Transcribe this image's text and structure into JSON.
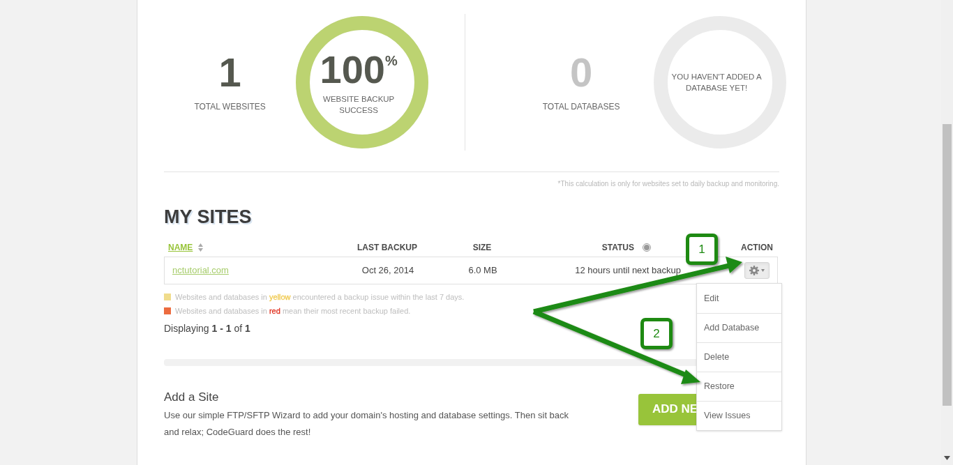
{
  "stats": [
    {
      "kind": "count",
      "value": "1",
      "label": "TOTAL WEBSITES",
      "muted": false
    },
    {
      "kind": "ring",
      "value": "100",
      "unit": "%",
      "label": "WEBSITE BACKUP SUCCESS",
      "level": 1
    },
    {
      "kind": "count",
      "value": "0",
      "label": "TOTAL DATABASES",
      "muted": true
    },
    {
      "kind": "ring",
      "message": "YOU HAVEN'T ADDED A DATABASE YET!",
      "level": 0
    }
  ],
  "footnote": "*This calculation is only for websites set to daily backup and monitoring.",
  "section_title": "MY SITES",
  "table": {
    "columns": [
      {
        "label": "NAME",
        "sorted": true
      },
      {
        "label": "LAST BACKUP",
        "sorted": false
      },
      {
        "label": "SIZE",
        "sorted": false
      },
      {
        "label": "STATUS",
        "sorted": false
      },
      {
        "label": "ACTION",
        "sorted": false
      }
    ],
    "rows": [
      {
        "name": "nctutorial.com",
        "last_backup": "Oct 26, 2014",
        "size": "6.0 MB",
        "status": "12 hours until next backup"
      }
    ]
  },
  "legend": [
    {
      "color": "#f0dc8c",
      "before": "Websites and databases in",
      "highlight": {
        "text": "yellow",
        "color": "#efc84a"
      },
      "after": "encountered a backup issue within the last 7 days."
    },
    {
      "color": "#ec6b3f",
      "before": "Websites and databases in",
      "highlight": {
        "text": "red",
        "color": "#e0301e"
      },
      "after": "mean their most recent backup failed."
    }
  ],
  "pagination": "Displaying **1 - 1** of **1**",
  "add_site": {
    "title": "Add a Site",
    "text": "Use our simple FTP/SFTP Wizard to add your domain's hosting and database settings. Then sit back and relax; CodeGuard does the rest!",
    "button": "ADD NE"
  },
  "action_menu": {
    "open": true,
    "items": [
      "Edit",
      "Add Database",
      "Delete",
      "Restore",
      "View Issues"
    ]
  },
  "callouts": [
    "1",
    "2"
  ]
}
